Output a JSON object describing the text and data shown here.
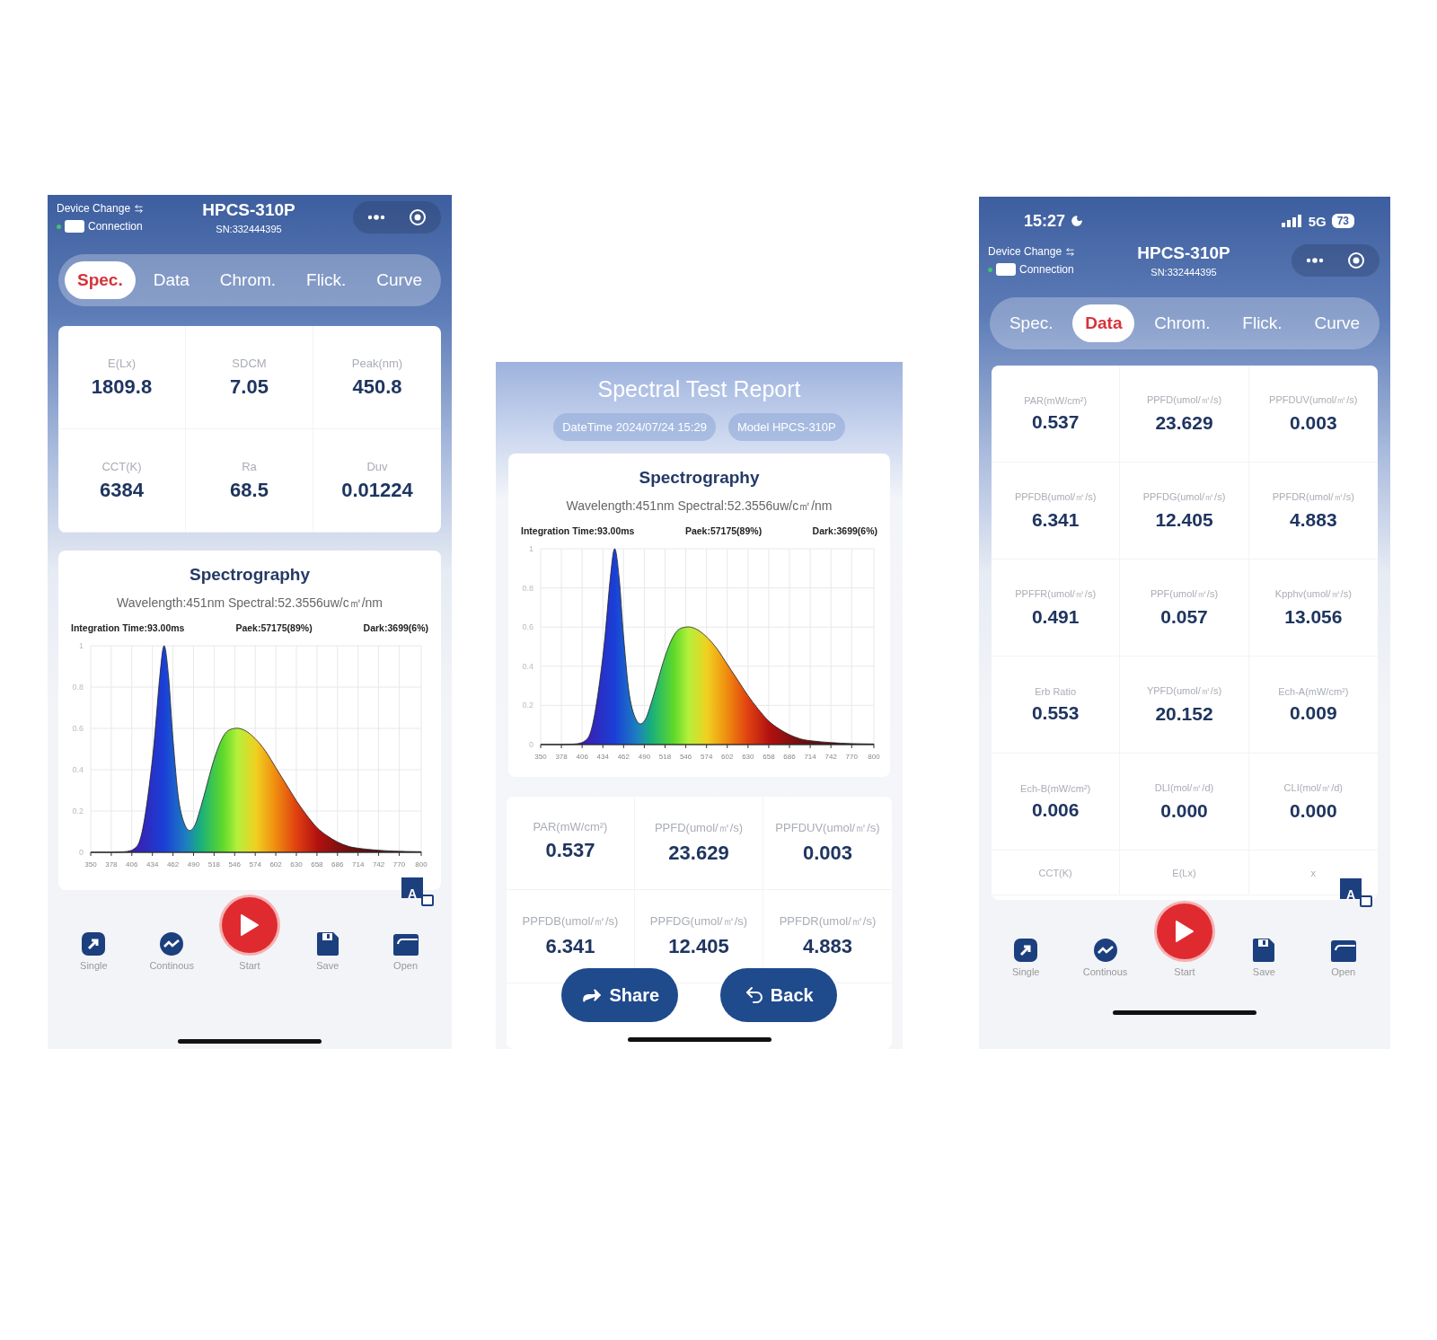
{
  "screens": [
    {
      "kind": "measure",
      "header": {
        "device_change": "Device Change",
        "connection": "Connection",
        "connected": true,
        "toggle_on": true,
        "title": "HPCS-310P",
        "serial": "SN:332444395"
      },
      "tabs": [
        {
          "label": "Spec.",
          "selected": true
        },
        {
          "label": "Data",
          "selected": false
        },
        {
          "label": "Chrom.",
          "selected": false
        },
        {
          "label": "Flick.",
          "selected": false
        },
        {
          "label": "Curve",
          "selected": false
        }
      ],
      "panels": [
        {
          "kind": "metrics",
          "cells": [
            {
              "label": "E(Lx)",
              "value": "1809.8"
            },
            {
              "label": "SDCM",
              "value": "7.05"
            },
            {
              "label": "Peak(nm)",
              "value": "450.8"
            },
            {
              "label": "CCT(K)",
              "value": "6384"
            },
            {
              "label": "Ra",
              "value": "68.5"
            },
            {
              "label": "Duv",
              "value": "0.01224"
            }
          ]
        },
        {
          "kind": "spectro",
          "title": "Spectrography",
          "wavelength": "Wavelength:451nm Spectral:52.3556uw/c㎡/nm",
          "integration": "Integration Time:93.00ms",
          "peak": "Paek:57175(89%)",
          "dark": "Dark:3699(6%)",
          "chart_data": {
            "type": "area",
            "x": [
              350,
              378,
              406,
              420,
              434,
              444,
              450,
              456,
              462,
              470,
              480,
              490,
              500,
              518,
              532,
              546,
              560,
              574,
              588,
              602,
              616,
              630,
              644,
              658,
              672,
              686,
              700,
              714,
              742,
              770,
              800
            ],
            "values": [
              0,
              0,
              0.01,
              0.1,
              0.45,
              0.85,
              1,
              0.85,
              0.55,
              0.25,
              0.12,
              0.12,
              0.22,
              0.45,
              0.57,
              0.6,
              0.59,
              0.55,
              0.49,
              0.41,
              0.33,
              0.25,
              0.18,
              0.12,
              0.08,
              0.05,
              0.03,
              0.02,
              0.01,
              0.005,
              0.003
            ],
            "xlim": [
              350,
              800
            ],
            "ylim": [
              0,
              1
            ],
            "xticks": [
              350,
              378,
              406,
              434,
              462,
              490,
              518,
              546,
              574,
              602,
              630,
              658,
              686,
              714,
              742,
              770,
              800
            ],
            "yticks": [
              0,
              0.2,
              0.4,
              0.6,
              0.8,
              1
            ],
            "grid": true
          }
        }
      ],
      "translate_badge": "A",
      "nav": [
        {
          "kind": "single",
          "label": "Single"
        },
        {
          "kind": "continuous",
          "label": "Continous"
        },
        {
          "kind": "start",
          "label": "Start"
        },
        {
          "kind": "save",
          "label": "Save"
        },
        {
          "kind": "open",
          "label": "Open"
        }
      ]
    },
    {
      "kind": "report",
      "title": "Spectral Test Report",
      "chips": [
        "DateTime 2024/07/24 15:29",
        "Model HPCS-310P"
      ],
      "panels": [
        {
          "kind": "spectro",
          "title": "Spectrography",
          "wavelength": "Wavelength:451nm Spectral:52.3556uw/c㎡/nm",
          "integration": "Integration Time:93.00ms",
          "peak": "Paek:57175(89%)",
          "dark": "Dark:3699(6%)",
          "chart_data": {
            "type": "area",
            "x": [
              350,
              378,
              406,
              420,
              434,
              444,
              450,
              456,
              462,
              470,
              480,
              490,
              500,
              518,
              532,
              546,
              560,
              574,
              588,
              602,
              616,
              630,
              644,
              658,
              672,
              686,
              700,
              714,
              742,
              770,
              800
            ],
            "values": [
              0,
              0,
              0.01,
              0.1,
              0.45,
              0.85,
              1,
              0.85,
              0.55,
              0.25,
              0.12,
              0.12,
              0.22,
              0.45,
              0.57,
              0.6,
              0.59,
              0.55,
              0.49,
              0.41,
              0.33,
              0.25,
              0.18,
              0.12,
              0.08,
              0.05,
              0.03,
              0.02,
              0.01,
              0.005,
              0.003
            ],
            "xlim": [
              350,
              800
            ],
            "ylim": [
              0,
              1
            ],
            "xticks": [
              350,
              378,
              406,
              434,
              462,
              490,
              518,
              546,
              574,
              602,
              630,
              658,
              686,
              714,
              742,
              770,
              800
            ],
            "yticks": [
              0,
              0.2,
              0.4,
              0.6,
              0.8,
              1
            ],
            "grid": true
          }
        },
        {
          "kind": "metrics",
          "cells": [
            {
              "label": "PAR(mW/cm²)",
              "value": "0.537"
            },
            {
              "label": "PPFD(umol/㎡/s)",
              "value": "23.629"
            },
            {
              "label": "PPFDUV(umol/㎡/s)",
              "value": "0.003"
            },
            {
              "label": "PPFDB(umol/㎡/s)",
              "value": "6.341"
            },
            {
              "label": "PPFDG(umol/㎡/s)",
              "value": "12.405"
            },
            {
              "label": "PPFDR(umol/㎡/s)",
              "value": "4.883"
            }
          ]
        }
      ],
      "actions": [
        {
          "kind": "share",
          "label": "Share"
        },
        {
          "kind": "back",
          "label": "Back"
        }
      ]
    },
    {
      "kind": "measure",
      "status_bar": {
        "time": "15:27",
        "network": "5G",
        "battery": "73"
      },
      "header": {
        "device_change": "Device Change",
        "connection": "Connection",
        "connected": true,
        "toggle_on": true,
        "title": "HPCS-310P",
        "serial": "SN:332444395"
      },
      "tabs": [
        {
          "label": "Spec.",
          "selected": false
        },
        {
          "label": "Data",
          "selected": true
        },
        {
          "label": "Chrom.",
          "selected": false
        },
        {
          "label": "Flick.",
          "selected": false
        },
        {
          "label": "Curve",
          "selected": false
        }
      ],
      "panels": [
        {
          "kind": "datagrid",
          "cells": [
            {
              "label": "PAR(mW/cm²)",
              "value": "0.537"
            },
            {
              "label": "PPFD(umol/㎡/s)",
              "value": "23.629"
            },
            {
              "label": "PPFDUV(umol/㎡/s)",
              "value": "0.003"
            },
            {
              "label": "PPFDB(umol/㎡/s)",
              "value": "6.341"
            },
            {
              "label": "PPFDG(umol/㎡/s)",
              "value": "12.405"
            },
            {
              "label": "PPFDR(umol/㎡/s)",
              "value": "4.883"
            },
            {
              "label": "PPFFR(umol/㎡/s)",
              "value": "0.491"
            },
            {
              "label": "PPF(umol/㎡/s)",
              "value": "0.057"
            },
            {
              "label": "Kpphv(umol/㎡/s)",
              "value": "13.056"
            },
            {
              "label": "Erb Ratio",
              "value": "0.553"
            },
            {
              "label": "YPFD(umol/㎡/s)",
              "value": "20.152"
            },
            {
              "label": "Ech-A(mW/cm²)",
              "value": "0.009"
            },
            {
              "label": "Ech-B(mW/cm²)",
              "value": "0.006"
            },
            {
              "label": "DLI(mol/㎡/d)",
              "value": "0.000"
            },
            {
              "label": "CLI(mol/㎡/d)",
              "value": "0.000"
            },
            {
              "label": "CCT(K)"
            },
            {
              "label": "E(Lx)"
            },
            {
              "label": "x"
            }
          ]
        }
      ],
      "translate_badge": "A",
      "nav": [
        {
          "kind": "single",
          "label": "Single"
        },
        {
          "kind": "continuous",
          "label": "Continous"
        },
        {
          "kind": "start",
          "label": "Start"
        },
        {
          "kind": "save",
          "label": "Save"
        },
        {
          "kind": "open",
          "label": "Open"
        }
      ]
    }
  ]
}
